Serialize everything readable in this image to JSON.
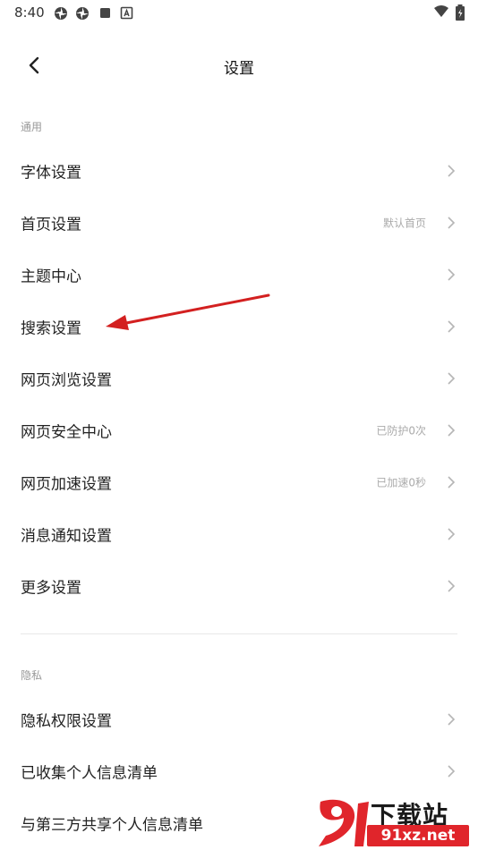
{
  "status_bar": {
    "time": "8:40",
    "icons": [
      "pinwheel-icon",
      "pinwheel-icon",
      "square-icon",
      "a-badge-icon",
      "wifi-icon",
      "battery-icon"
    ]
  },
  "header": {
    "title": "设置",
    "back_icon": "chevron-left-icon"
  },
  "sections": {
    "general": {
      "label": "通用",
      "items": [
        {
          "label": "字体设置",
          "value": ""
        },
        {
          "label": "首页设置",
          "value": "默认首页"
        },
        {
          "label": "主题中心",
          "value": ""
        },
        {
          "label": "搜索设置",
          "value": ""
        },
        {
          "label": "网页浏览设置",
          "value": ""
        },
        {
          "label": "网页安全中心",
          "value": "已防护0次"
        },
        {
          "label": "网页加速设置",
          "value": "已加速0秒"
        },
        {
          "label": "消息通知设置",
          "value": ""
        },
        {
          "label": "更多设置",
          "value": ""
        }
      ]
    },
    "privacy": {
      "label": "隐私",
      "items": [
        {
          "label": "隐私权限设置",
          "value": ""
        },
        {
          "label": "已收集个人信息清单",
          "value": ""
        },
        {
          "label": "与第三方共享个人信息清单",
          "value": ""
        }
      ]
    }
  },
  "watermark": {
    "brand": "下载站",
    "site": "91xz.net"
  },
  "colors": {
    "annotation_arrow": "#d32020",
    "watermark_red": "#e0252b",
    "value_text": "#aaaaaa",
    "section_label": "#999999"
  }
}
